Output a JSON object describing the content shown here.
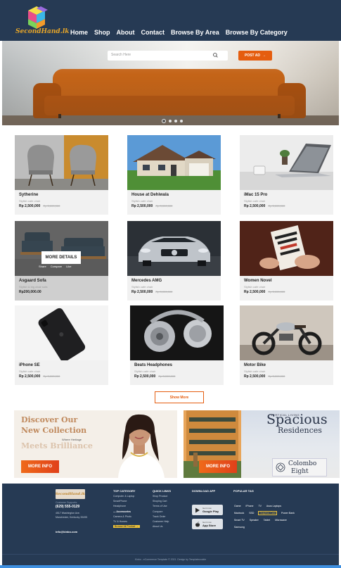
{
  "brand": {
    "name": "SecondHand.lk",
    "colors": {
      "header_bg": "#263a54",
      "accent": "#e55d0f",
      "price_accent": "#222222"
    }
  },
  "nav": {
    "items": [
      "Home",
      "Shop",
      "About",
      "Contact",
      "Browse By Area",
      "Browse By Category"
    ]
  },
  "hero": {
    "search_placeholder": "Search Here",
    "search_icon": "search-icon",
    "post_ad_label": "POST AD",
    "post_ad_icon": "arrow-right-icon",
    "slide_count": 4,
    "active_slide": 1
  },
  "products": [
    {
      "name": "Sytherine",
      "subtitle": "Stylish cafe chair",
      "price": "Rp 2,500,000",
      "old_price": "Rp 3,000,000"
    },
    {
      "name": "House at Dehiwala",
      "subtitle": "Stylish cafe chair",
      "price": "Rp 2,500,000",
      "old_price": "Rp 3,000,000"
    },
    {
      "name": "iMac 15 Pro",
      "subtitle": "Stylish cafe chair",
      "price": "Rp 2,500,000",
      "old_price": "Rp 3,000,000"
    },
    {
      "name": "Asgaard Sofa",
      "subtitle": "Stylish & big chair sofa",
      "price": "Rp200,000.00",
      "old_price": "",
      "hover": {
        "button": "MORE DETAILS",
        "actions": [
          "Share",
          "Compare",
          "Like"
        ]
      }
    },
    {
      "name": "Mercedes AMG",
      "subtitle": "Stylish cafe chair",
      "price": "Rp 2,500,000",
      "old_price": "Rp 3,000,000"
    },
    {
      "name": "Women Novel",
      "subtitle": "Stylish cafe chair",
      "price": "Rp 2,500,000",
      "old_price": "Rp 3,000,000"
    },
    {
      "name": "iPhone SE",
      "subtitle": "Stylish cafe chair",
      "price": "Rp 2,500,000",
      "old_price": "Rp 3,000,000"
    },
    {
      "name": "Beats Headphones",
      "subtitle": "Stylish cafe chair",
      "price": "Rp 2,500,000",
      "old_price": "Rp 3,000,000"
    },
    {
      "name": "Motor Bike",
      "subtitle": "Stylish cafe chair",
      "price": "Rp 2,500,000",
      "old_price": "Rp 3,000,000"
    }
  ],
  "show_more_label": "Show More",
  "banners": {
    "left": {
      "line1": "Discover Our",
      "line2": "New Collection",
      "line3": "Meets Brilliance",
      "small": "Where Heritage",
      "button": "MORE INFO"
    },
    "right": {
      "small": "VERTICAL LIVING",
      "title": "Spacious",
      "subtitle": "Residences",
      "button": "MORE INFO",
      "logo_line1": "Colombo",
      "logo_line2": "Eight"
    }
  },
  "footer": {
    "logo": "SecondHand.lk",
    "support_label": "Customer Supports:",
    "phone": "(629) 555-0129",
    "address_line1": "4517 Washington Ave.",
    "address_line2": "Manchester, Kentucky 39495",
    "email": "info@kinbo.com",
    "top_category": {
      "heading": "TOP CATEGORY",
      "items": [
        "Computer & Laptop",
        "SmartPhone",
        "Headphone",
        "Accessories",
        "Camera & Photo",
        "TV & Homes"
      ],
      "active": "Accessories",
      "browse": "Browse All Product"
    },
    "quick_links": {
      "heading": "QUICK LINKS",
      "items": [
        "Shop Product",
        "Shoping Cart",
        "Terms of Use",
        "Compare",
        "Track Order",
        "Customer Help",
        "About Us"
      ]
    },
    "download_app": {
      "heading": "DOWNLOAD APP",
      "google": {
        "small": "Get it now",
        "big": "Google Play"
      },
      "apple": {
        "small": "Get it now",
        "big": "App Store"
      }
    },
    "popular_tag": {
      "heading": "POPULAR TAG",
      "tags": [
        "Game",
        "iPhone",
        "TV",
        "Asus Laptops",
        "Macbook",
        "SSD",
        "Graphics Card",
        "Power Bank",
        "Smart TV",
        "Speaker",
        "Tablet",
        "Microwave",
        "Samsung"
      ],
      "selected": "Graphics Card"
    },
    "copyright": "Kinbo - eCommerce Template © 2021. Design by Templatecookie"
  }
}
